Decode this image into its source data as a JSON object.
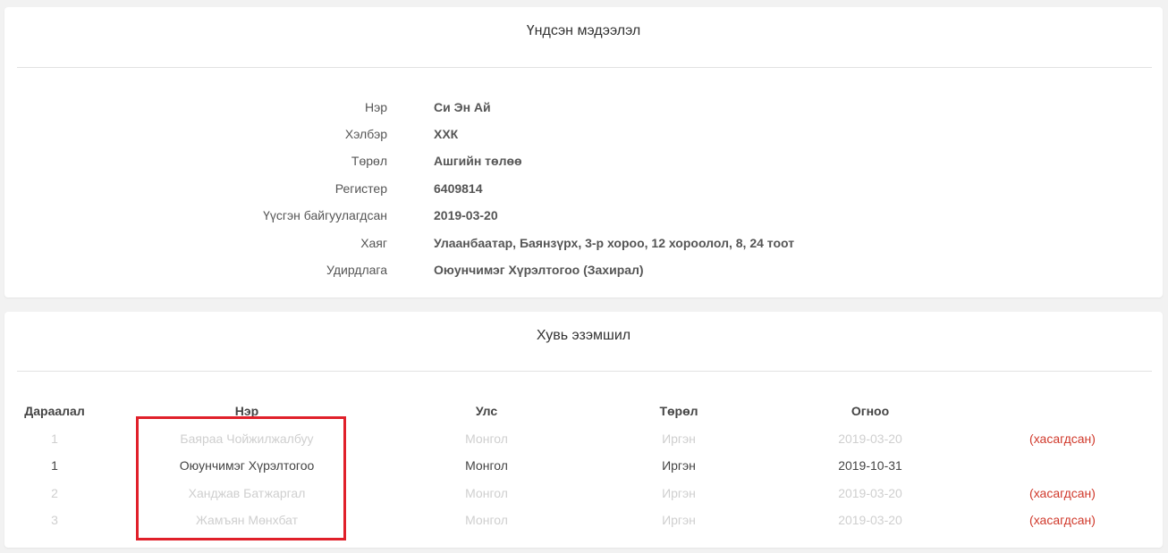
{
  "basic_info": {
    "title": "Үндсэн мэдээлэл",
    "rows": [
      {
        "label": "Нэр",
        "value": "Си Эн Ай"
      },
      {
        "label": "Хэлбэр",
        "value": "ХХК"
      },
      {
        "label": "Төрөл",
        "value": "Ашгийн төлөө"
      },
      {
        "label": "Регистер",
        "value": "6409814"
      },
      {
        "label": "Үүсгэн байгуулагдсан",
        "value": "2019-03-20"
      },
      {
        "label": "Хаяг",
        "value": "Улаанбаатар, Баянзүрх, 3-р хороо, 12 хороолол, 8, 24 тоот"
      },
      {
        "label": "Удирдлага",
        "value": "Оюунчимэг Хүрэлтогоо (Захирал)"
      }
    ]
  },
  "ownership": {
    "title": "Хувь эзэмшил",
    "headers": {
      "order": "Дараалал",
      "name": "Нэр",
      "country": "Улс",
      "type": "Төрөл",
      "date": "Огноо"
    },
    "rows": [
      {
        "order": "1",
        "name": "Баяраа Чойжилжалбуу",
        "country": "Монгол",
        "type": "Иргэн",
        "date": "2019-03-20",
        "status": "(хасагдсан)",
        "removed": true
      },
      {
        "order": "1",
        "name": "Оюунчимэг Хүрэлтогоо",
        "country": "Монгол",
        "type": "Иргэн",
        "date": "2019-10-31",
        "status": "",
        "removed": false
      },
      {
        "order": "2",
        "name": "Ханджав Батжаргал",
        "country": "Монгол",
        "type": "Иргэн",
        "date": "2019-03-20",
        "status": "(хасагдсан)",
        "removed": true
      },
      {
        "order": "3",
        "name": "Жамъян Мөнхбат",
        "country": "Монгол",
        "type": "Иргэн",
        "date": "2019-03-20",
        "status": "(хасагдсан)",
        "removed": true
      }
    ]
  },
  "colors": {
    "removed_status": "#d0392b",
    "highlight_box": "#e0202a",
    "muted_text": "#cfcfcf"
  }
}
